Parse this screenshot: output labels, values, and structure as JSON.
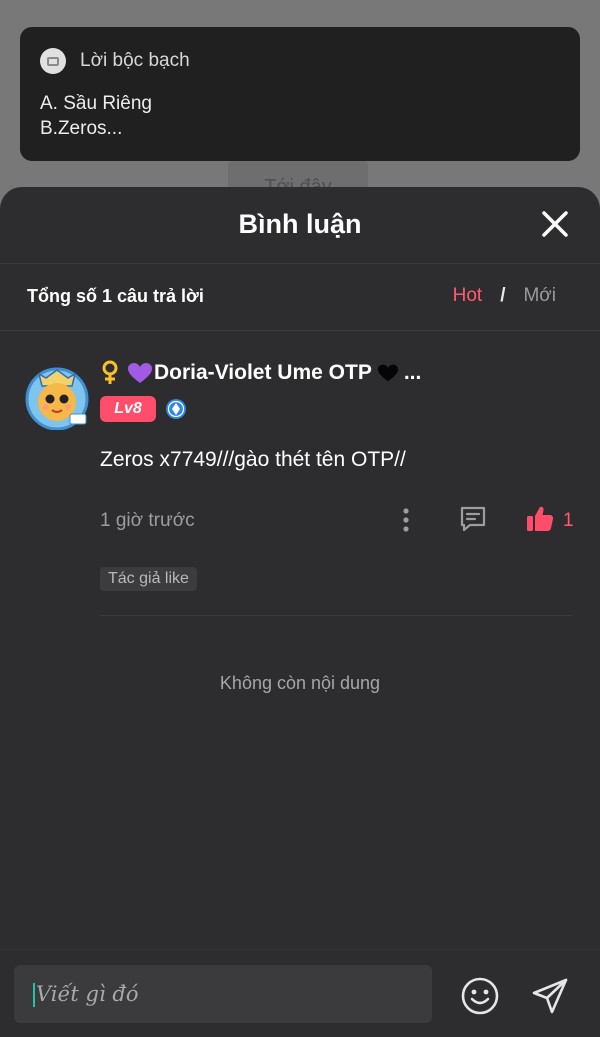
{
  "background": {
    "button_label": "Tới đây"
  },
  "notification": {
    "title": "Lời bộc bạch",
    "lines": [
      "A. Sầu Riêng",
      "B.Zeros..."
    ]
  },
  "sheet": {
    "title": "Bình luận",
    "total": "Tổng số 1 câu trả lời",
    "sort": {
      "hot": "Hot",
      "separator": "/",
      "new": "Mới"
    },
    "comment": {
      "author": "Doria-Violet Ume OTP",
      "author_suffix": "...",
      "level": "Lv8",
      "text": "Zeros x7749///gào thét tên OTP//",
      "time": "1 giờ trước",
      "likes": "1",
      "author_like_tag": "Tác giả like"
    },
    "no_more": "Không còn nội dung",
    "input": {
      "placeholder": "Viết gì đó"
    }
  },
  "colors": {
    "accent": "#ff5a72",
    "sheet_bg": "#2d2d2f",
    "notif_bg": "#202020",
    "caret": "#22c3a6"
  }
}
